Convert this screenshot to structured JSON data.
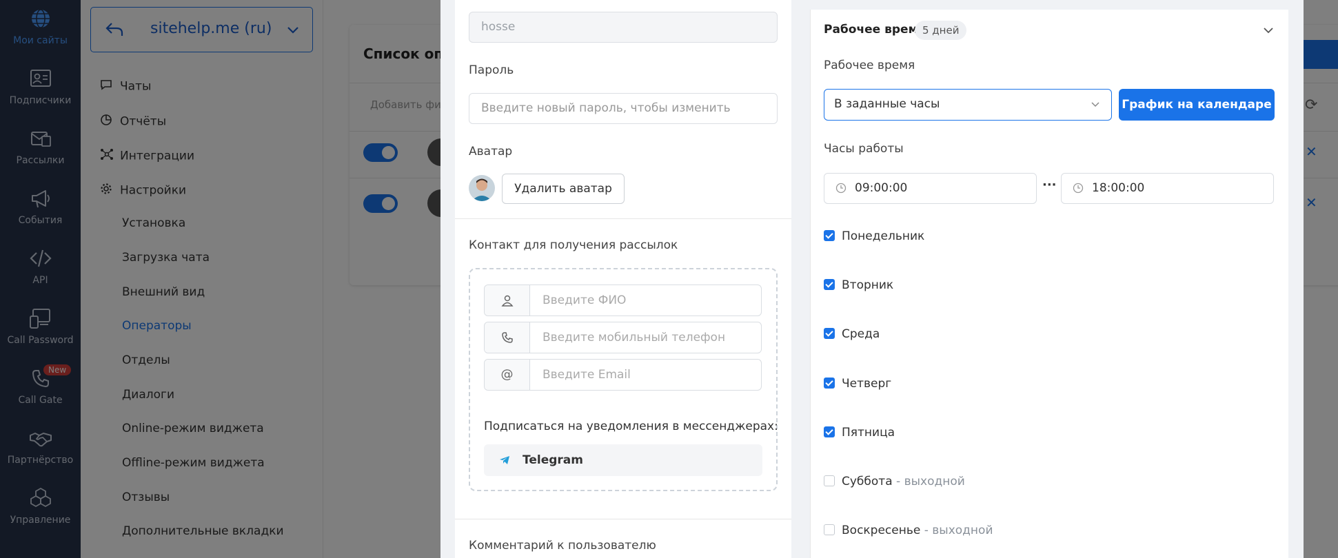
{
  "rail": [
    {
      "label": "Мои сайты",
      "icon": "globe-icon"
    },
    {
      "label": "Подписчики",
      "icon": "contact-card-icon"
    },
    {
      "label": "Рассылки",
      "icon": "mailing-icon"
    },
    {
      "label": "События",
      "icon": "megaphone-icon"
    },
    {
      "label": "API",
      "icon": "code-icon"
    },
    {
      "label": "Call Password",
      "icon": "devices-icon"
    },
    {
      "label": "Call Gate",
      "icon": "phone-icon",
      "badge": "New"
    },
    {
      "label": "Партнёрство",
      "icon": "handshake-icon"
    },
    {
      "label": "Управление",
      "icon": "boxes-icon"
    }
  ],
  "sidebar": {
    "site": "sitehelp.me (ru)",
    "main": [
      "Чаты",
      "Отчёты",
      "Интеграции",
      "Настройки"
    ],
    "settings": [
      "Установка",
      "Загрузка чата",
      "Внешний вид",
      "Операторы",
      "Отделы",
      "Диалоги",
      "Online-режим виджета",
      "Offline-режим виджета",
      "Отзывы",
      "Дополнительные вкладки"
    ],
    "active": "Операторы"
  },
  "background": {
    "title": "Список опе",
    "filter": "Добавить фил"
  },
  "form": {
    "login_value": "hosse",
    "password_label": "Пароль",
    "password_placeholder": "Введите новый пароль, чтобы изменить",
    "avatar_label": "Аватар",
    "delete_avatar": "Удалить аватар",
    "contact_label": "Контакт для получения рассылок",
    "name_placeholder": "Введите ФИО",
    "phone_placeholder": "Введите мобильный телефон",
    "email_placeholder": "Введите Email",
    "email_prefix": "@",
    "subscribe_label": "Подписаться на уведомления в мессенджерах:",
    "telegram": "Telegram",
    "comment_label": "Комментарий к пользователю"
  },
  "worktime": {
    "header": "Рабочее время",
    "days_pill": "5 дней",
    "label": "Рабочее время",
    "mode": "В заданные часы",
    "calendar_button": "График на календаре",
    "hours_label": "Часы работы",
    "start": "09:00:00",
    "end": "18:00:00",
    "separator": "···",
    "days": [
      {
        "name": "Понедельник",
        "checked": true,
        "note": ""
      },
      {
        "name": "Вторник",
        "checked": true,
        "note": ""
      },
      {
        "name": "Среда",
        "checked": true,
        "note": ""
      },
      {
        "name": "Четверг",
        "checked": true,
        "note": ""
      },
      {
        "name": "Пятница",
        "checked": true,
        "note": ""
      },
      {
        "name": "Суббота",
        "checked": false,
        "note": " - выходной"
      },
      {
        "name": "Воскресенье",
        "checked": false,
        "note": " - выходной"
      }
    ]
  },
  "colors": {
    "accent": "#1a73e8",
    "rail": "#27324b",
    "badge": "#d43f3a"
  }
}
